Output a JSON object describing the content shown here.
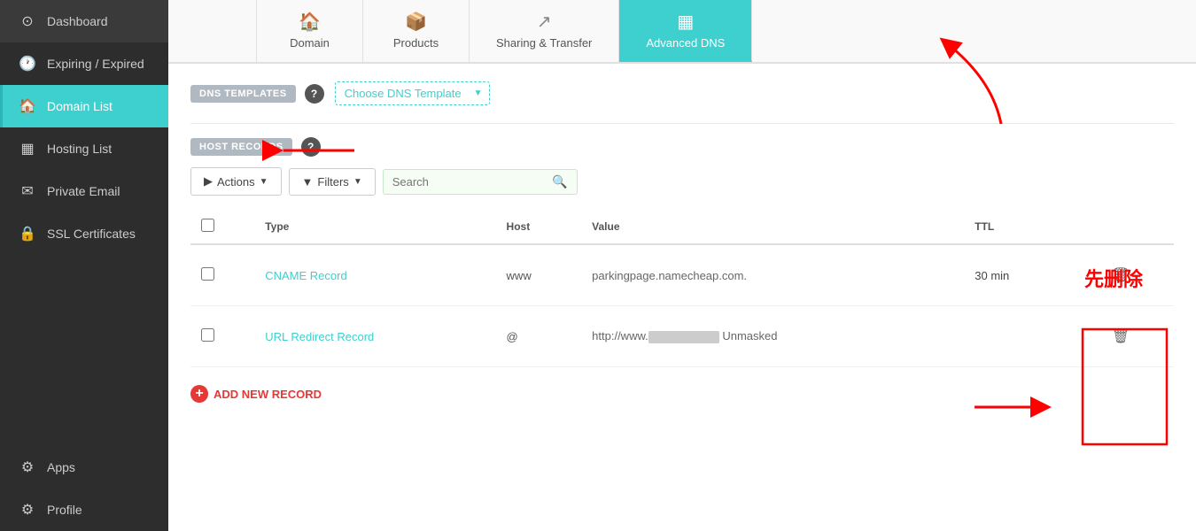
{
  "sidebar": {
    "items": [
      {
        "id": "dashboard",
        "label": "Dashboard",
        "icon": "⊙",
        "active": false
      },
      {
        "id": "expiring",
        "label": "Expiring / Expired",
        "icon": "🕐",
        "active": false
      },
      {
        "id": "domain-list",
        "label": "Domain List",
        "icon": "🏠",
        "active": true
      },
      {
        "id": "hosting-list",
        "label": "Hosting List",
        "icon": "▦",
        "active": false
      },
      {
        "id": "private-email",
        "label": "Private Email",
        "icon": "✉",
        "active": false
      },
      {
        "id": "ssl-certificates",
        "label": "SSL Certificates",
        "icon": "🔒",
        "active": false
      },
      {
        "id": "apps",
        "label": "Apps",
        "icon": "⚙",
        "active": false
      },
      {
        "id": "profile",
        "label": "Profile",
        "icon": "⚙",
        "active": false
      }
    ]
  },
  "tabs": [
    {
      "id": "domain",
      "label": "Domain",
      "icon": "🏠",
      "active": false
    },
    {
      "id": "products",
      "label": "Products",
      "icon": "📦",
      "active": false
    },
    {
      "id": "sharing-transfer",
      "label": "Sharing & Transfer",
      "icon": "↗",
      "active": false
    },
    {
      "id": "advanced-dns",
      "label": "Advanced DNS",
      "icon": "▦",
      "active": true
    }
  ],
  "dns_section": {
    "label": "DNS TEMPLATES",
    "placeholder": "Choose DNS Template"
  },
  "host_records_section": {
    "label": "HOST RECORDS"
  },
  "toolbar": {
    "actions_label": "Actions",
    "filters_label": "Filters",
    "search_placeholder": "Search"
  },
  "table": {
    "columns": [
      "",
      "Type",
      "Host",
      "Value",
      "TTL",
      ""
    ],
    "rows": [
      {
        "type": "CNAME Record",
        "host": "www",
        "value": "parkingpage.namecheap.com.",
        "ttl": "30 min"
      },
      {
        "type": "URL Redirect Record",
        "host": "@",
        "value_prefix": "http://www.",
        "value_suffix": " Unmasked",
        "ttl": ""
      }
    ]
  },
  "add_record": {
    "label": "ADD NEW RECORD"
  },
  "annotation": {
    "first_delete_label": "先删除"
  }
}
